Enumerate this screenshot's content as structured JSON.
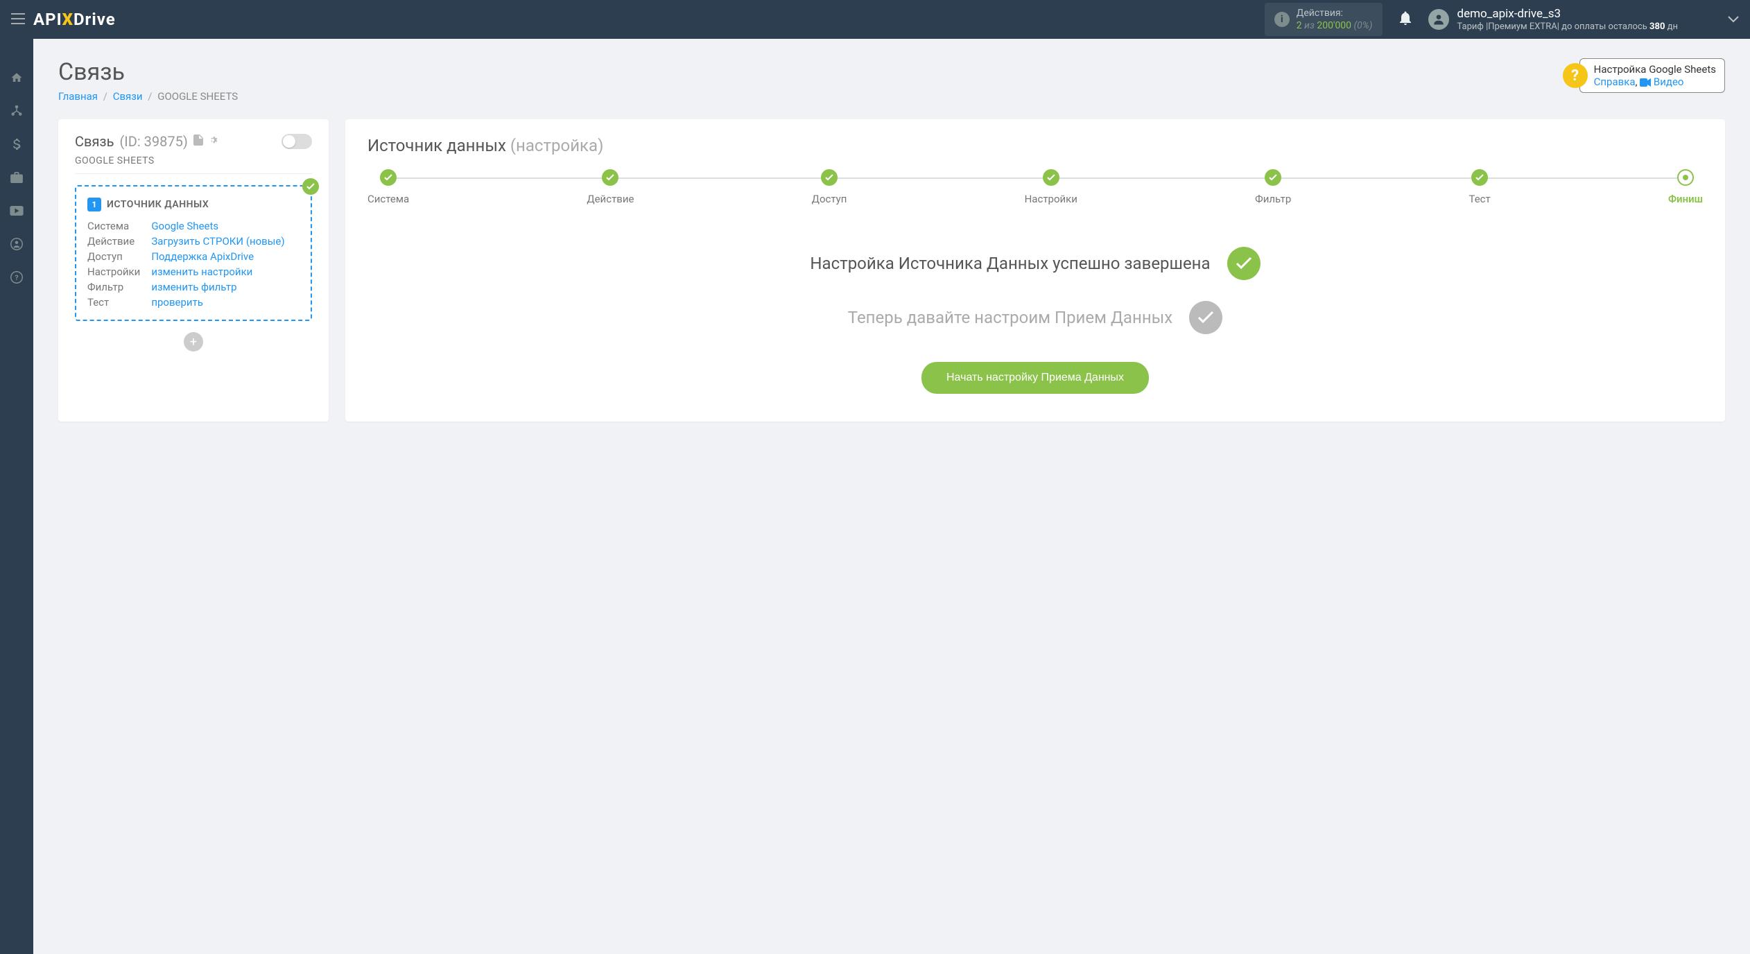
{
  "header": {
    "logo": {
      "api": "API",
      "x": "X",
      "drive": "Drive"
    },
    "actions": {
      "label": "Действия:",
      "value": "2",
      "of": "из",
      "total": "200'000",
      "pct": "(0%)"
    },
    "user": {
      "name": "demo_apix-drive_s3",
      "tariff_label": "Тариф",
      "tariff_name": "Премиум EXTRA",
      "payment_label": "до оплаты осталось",
      "days": "380",
      "days_unit": "дн"
    }
  },
  "page": {
    "title": "Связь",
    "breadcrumb": {
      "home": "Главная",
      "links": "Связи",
      "current": "GOOGLE SHEETS"
    }
  },
  "help": {
    "title": "Настройка Google Sheets",
    "link1": "Справка",
    "link2": "Видео"
  },
  "sidecard": {
    "title": "Связь",
    "id": "(ID: 39875)",
    "system": "GOOGLE SHEETS",
    "source": {
      "num": "1",
      "title": "ИСТОЧНИК ДАННЫХ",
      "rows": [
        {
          "label": "Система",
          "value": "Google Sheets"
        },
        {
          "label": "Действие",
          "value": "Загрузить СТРОКИ (новые)"
        },
        {
          "label": "Доступ",
          "value": "Поддержка ApixDrive"
        },
        {
          "label": "Настройки",
          "value": "изменить настройки"
        },
        {
          "label": "Фильтр",
          "value": "изменить фильтр"
        },
        {
          "label": "Тест",
          "value": "проверить"
        }
      ]
    }
  },
  "maincard": {
    "title": "Источник данных",
    "subtitle": "(настройка)",
    "steps": [
      "Система",
      "Действие",
      "Доступ",
      "Настройки",
      "Фильтр",
      "Тест",
      "Финиш"
    ],
    "status1": "Настройка Источника Данных успешно завершена",
    "status2": "Теперь давайте настроим Прием Данных",
    "cta": "Начать настройку Приема Данных"
  }
}
